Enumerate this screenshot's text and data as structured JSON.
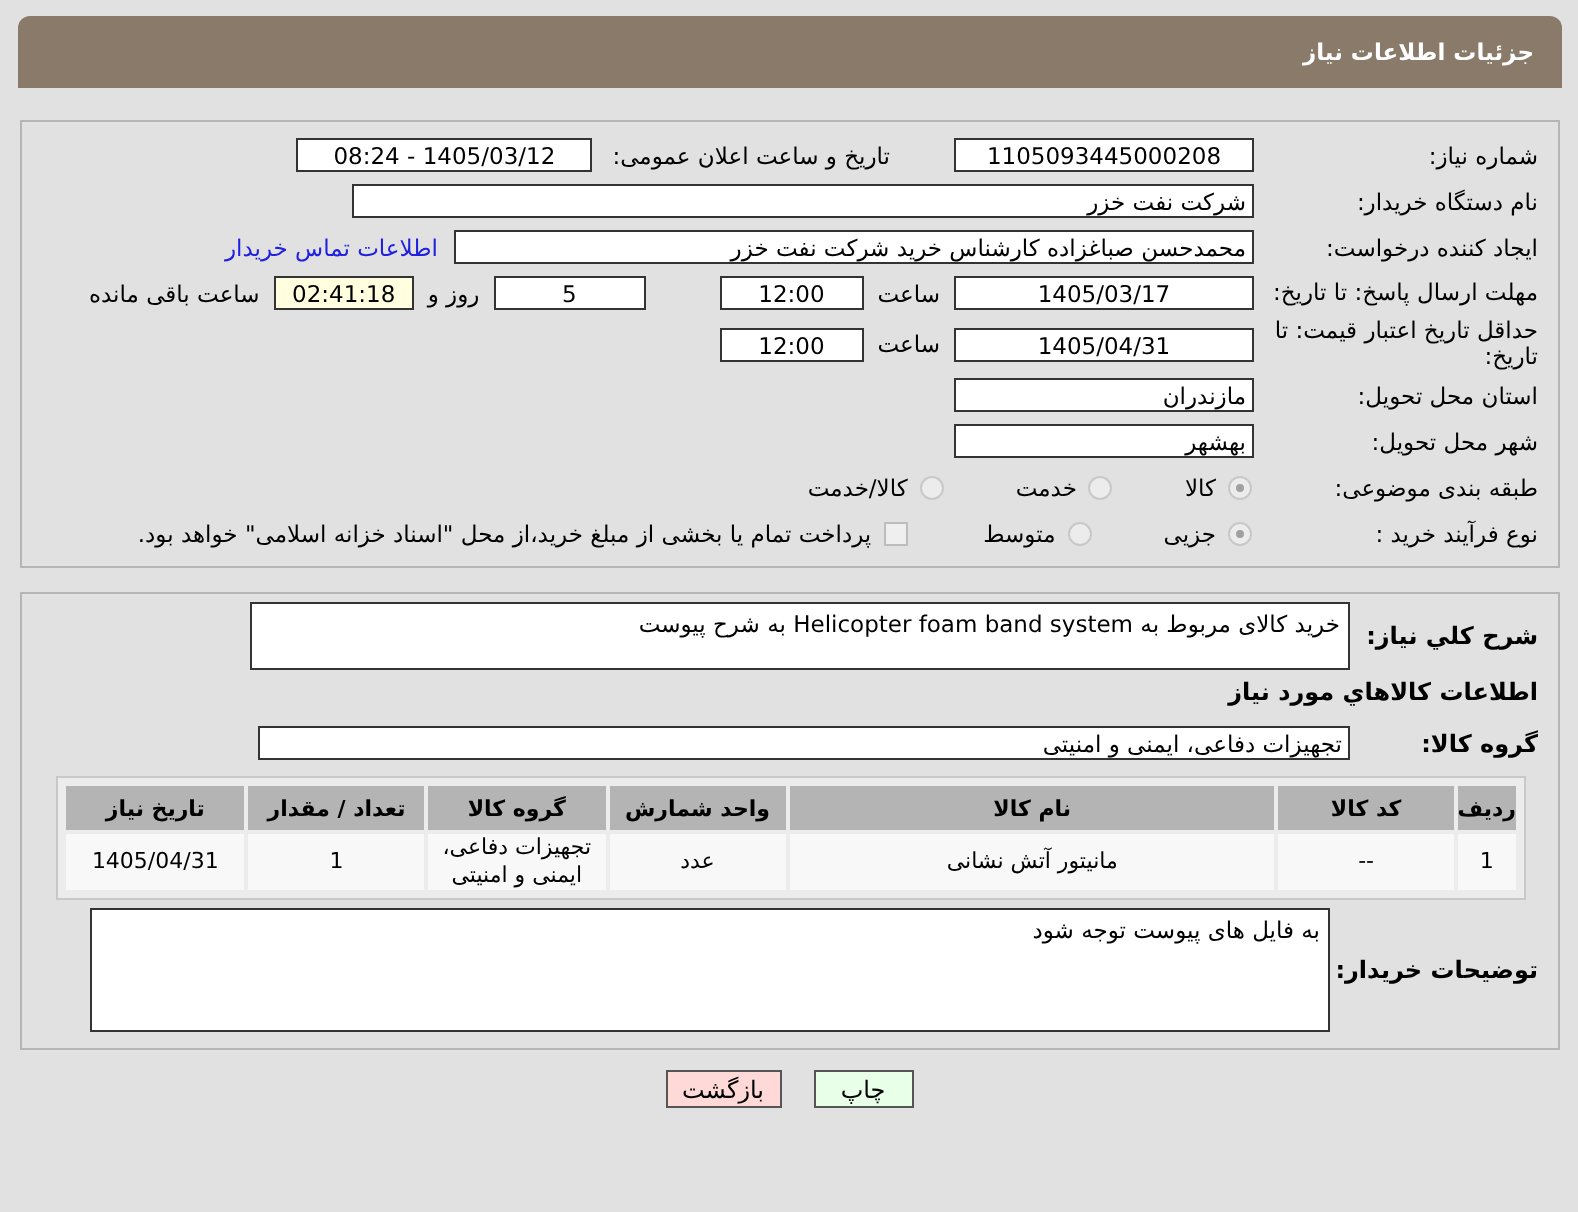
{
  "header": {
    "title": "جزئیات اطلاعات نیاز"
  },
  "details": {
    "need_number": {
      "label": "شماره نیاز:",
      "value": "1105093445000208"
    },
    "announce": {
      "label": "تاریخ و ساعت اعلان عمومی:",
      "value": "1405/03/12 - 08:24"
    },
    "buyer_org": {
      "label": "نام دستگاه خریدار:",
      "value": "شرکت نفت خزر"
    },
    "requester": {
      "label": "ایجاد کننده درخواست:",
      "value": "محمدحسن صباغزاده کارشناس خرید شرکت نفت خزر",
      "link": "اطلاعات تماس خریدار"
    },
    "deadline": {
      "label": "مهلت ارسال پاسخ: تا تاریخ:",
      "date": "1405/03/17",
      "time_label": "ساعت",
      "time": "12:00",
      "days": "5",
      "days_label": "روز و",
      "remaining": "02:41:18",
      "remaining_label": "ساعت باقی مانده"
    },
    "validity": {
      "label": "حداقل تاریخ اعتبار قیمت: تا تاریخ:",
      "date": "1405/04/31",
      "time_label": "ساعت",
      "time": "12:00"
    },
    "province": {
      "label": "استان محل تحویل:",
      "value": "مازندران"
    },
    "city": {
      "label": "شهر محل تحویل:",
      "value": "بهشهر"
    },
    "category": {
      "label": "طبقه بندی موضوعی:",
      "options": [
        {
          "label": "کالا",
          "selected": true
        },
        {
          "label": "خدمت",
          "selected": false
        },
        {
          "label": "کالا/خدمت",
          "selected": false
        }
      ]
    },
    "process": {
      "label": "نوع فرآیند خرید :",
      "options": [
        {
          "label": "جزیی",
          "selected": true
        },
        {
          "label": "متوسط",
          "selected": false
        }
      ],
      "treasury": {
        "label": "پرداخت تمام یا بخشی از مبلغ خرید،از محل \"اسناد خزانه اسلامی\" خواهد بود.",
        "checked": false
      }
    }
  },
  "summary": {
    "label": "شرح کلي نياز:",
    "value": "خرید کالای مربوط به Helicopter foam band system به شرح پیوست"
  },
  "goods": {
    "heading": "اطلاعات کالاهاي مورد نياز",
    "group_label": "گروه کالا:",
    "group": "تجهیزات دفاعی، ایمنی و امنیتی",
    "table": {
      "columns": [
        "ردیف",
        "کد کالا",
        "نام کالا",
        "واحد شمارش",
        "گروه کالا",
        "تعداد / مقدار",
        "تاریخ نیاز"
      ],
      "rows": [
        [
          "1",
          "--",
          "مانیتور آتش نشانی",
          "عدد",
          "تجهیزات دفاعی، ایمنی و امنیتی",
          "1",
          "1405/04/31"
        ]
      ]
    }
  },
  "notes": {
    "label": "توضیحات خریدار:",
    "value": "به فایل های پیوست توجه شود"
  },
  "buttons": [
    {
      "label": "چاپ",
      "kind": "print"
    },
    {
      "label": "بازگشت",
      "kind": "back"
    }
  ]
}
